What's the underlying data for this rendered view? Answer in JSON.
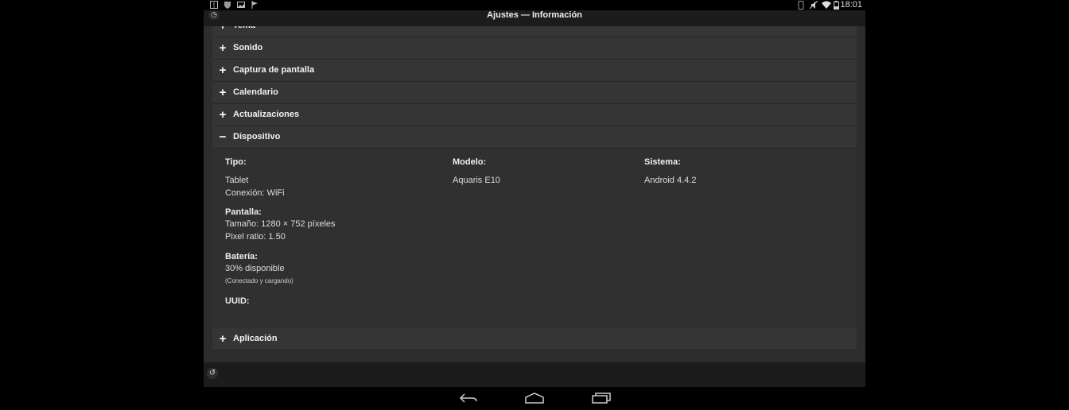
{
  "status_bar": {
    "time": "18:01",
    "left_icons": [
      "notification-icon",
      "shield-icon",
      "image-icon",
      "flag-icon"
    ],
    "right_icons": [
      "bluetooth-icon",
      "mute-icon",
      "wifi-icon",
      "battery-icon"
    ]
  },
  "header": {
    "title": "Ajustes — Información"
  },
  "sections": [
    {
      "label": "Tema",
      "expanded": false
    },
    {
      "label": "Sonido",
      "expanded": false
    },
    {
      "label": "Captura de pantalla",
      "expanded": false
    },
    {
      "label": "Calendario",
      "expanded": false
    },
    {
      "label": "Actualizaciones",
      "expanded": false
    },
    {
      "label": "Dispositivo",
      "expanded": true
    },
    {
      "label": "Aplicación",
      "expanded": false
    }
  ],
  "signs": {
    "collapsed": "+",
    "expanded": "−"
  },
  "device": {
    "type_label": "Tipo:",
    "type_value": "Tablet",
    "connection": "Conexión: WiFi",
    "screen_label": "Pantalla:",
    "screen_size": "Tamaño: 1280 × 752 píxeles",
    "pixel_ratio": "Pixel ratio: 1.50",
    "battery_label": "Batería:",
    "battery_value": "30% disponible",
    "battery_note": "(Conectado y cargando)",
    "uuid_label": "UUID:",
    "model_label": "Modelo:",
    "model_value": "Aquaris E10",
    "system_label": "Sistema:",
    "system_value": "Android 4.4.2"
  }
}
